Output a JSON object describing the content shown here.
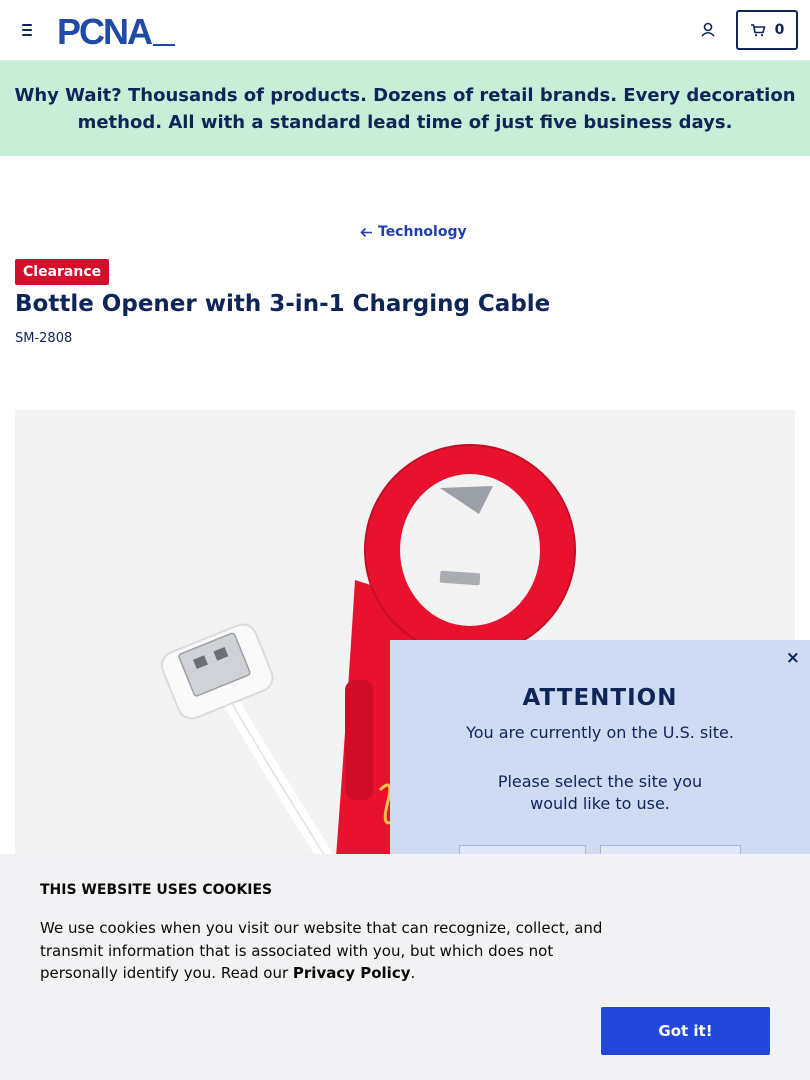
{
  "header": {
    "logo_text": "PCNA",
    "cart_count": "0",
    "icons": {
      "menu": "hamburger-menu-icon",
      "account": "user-icon",
      "cart": "cart-icon"
    }
  },
  "banner": {
    "text": "Why Wait? Thousands of products. Dozens of retail brands. Every decoration method. All with a standard lead time of just five business days."
  },
  "breadcrumb": {
    "back_label": "Technology"
  },
  "product": {
    "badge": "Clearance",
    "title": "Bottle Opener with 3-in-1 Charging Cable",
    "sku": "SM-2808"
  },
  "site_popup": {
    "close": "×",
    "heading": "ATTENTION",
    "current_site": "You are currently on the U.S. site.",
    "prompt_line1": "Please select the site you",
    "prompt_line2": "would like to use."
  },
  "cookie": {
    "title": "THIS WEBSITE USES COOKIES",
    "text": "We use cookies when you visit our website that can recognize, collect, and transmit information that is associated with you, but which does not personally identify you. Read our ",
    "link": "Privacy Policy",
    "end": ".",
    "button": "Got it!"
  },
  "colors": {
    "navy": "#0f2457",
    "banner_bg": "#c7efd8",
    "badge_red": "#d2102c",
    "button_blue": "#2347d9",
    "popup_bg": "#cfdbf2",
    "product_red": "#e8122e"
  }
}
